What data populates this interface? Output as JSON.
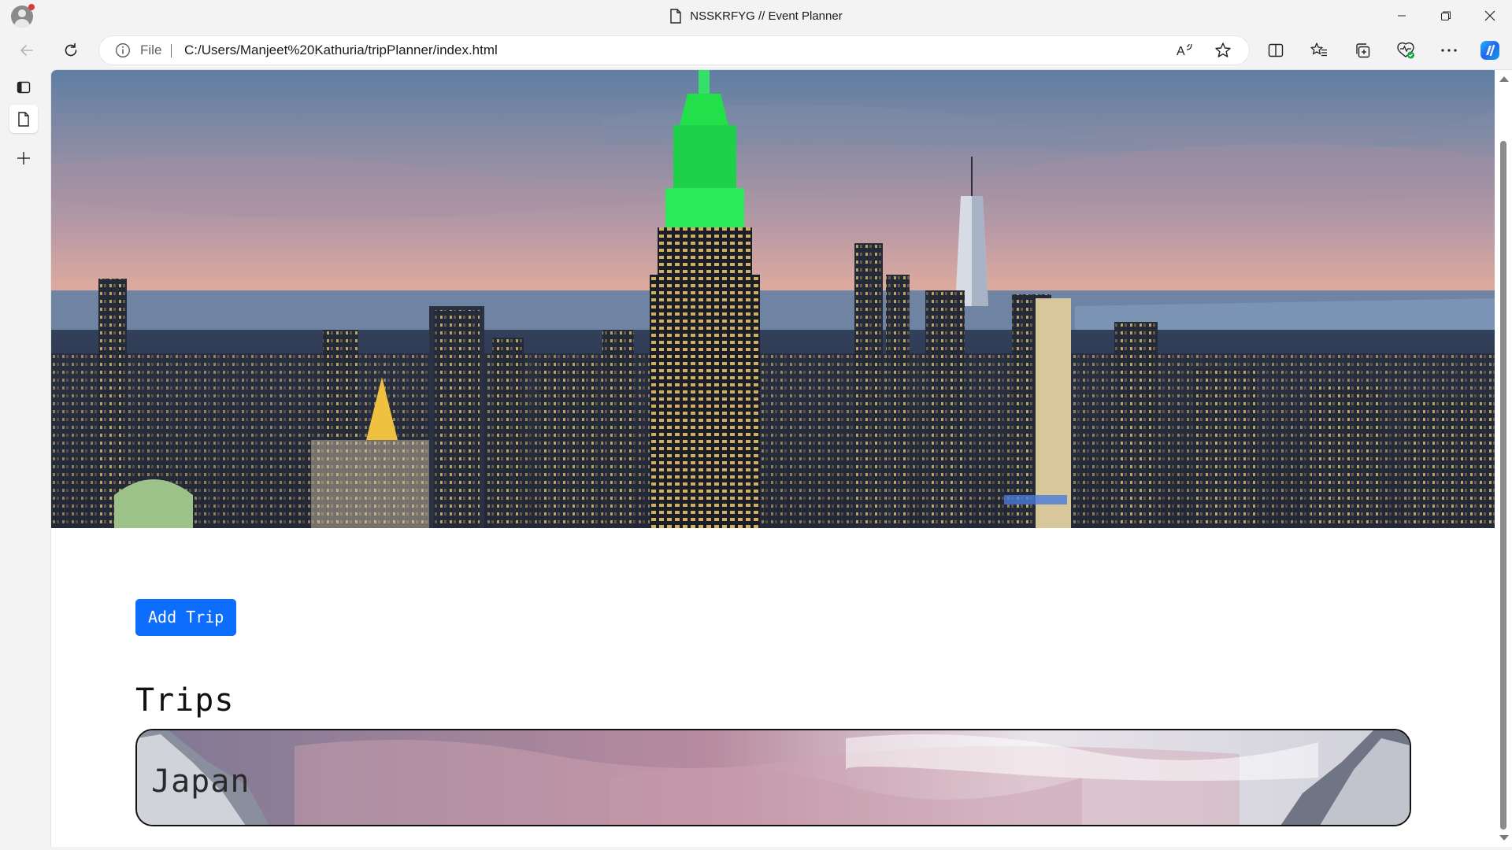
{
  "window": {
    "title": "NSSKRFYG // Event Planner",
    "page_icon": "document-icon"
  },
  "toolbar": {
    "back_icon": "back-arrow-icon",
    "refresh_icon": "refresh-icon",
    "address": {
      "scheme_label": "File",
      "url": "C:/Users/Manjeet%20Kathuria/tripPlanner/index.html"
    },
    "right_icons": [
      "read-aloud-icon",
      "favorite-star-icon",
      "split-screen-icon",
      "favorites-icon",
      "collections-icon",
      "browser-essentials-icon",
      "more-icon",
      "copilot-icon"
    ]
  },
  "sidebar": {
    "icons": [
      "tab-actions-icon",
      "tab-page-icon",
      "new-tab-icon"
    ]
  },
  "page": {
    "add_trip_label": "Add Trip",
    "trips_heading": "Trips",
    "trips": [
      {
        "name": "Japan"
      }
    ]
  },
  "colors": {
    "primary_button": "#0d6efd",
    "empire_green": "#22e04a"
  }
}
